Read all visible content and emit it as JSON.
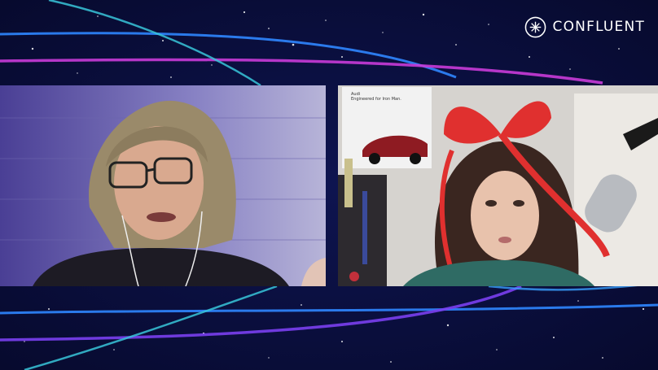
{
  "brand": {
    "name": "CONFLUENT",
    "logo_icon": "confluent-starburst-icon",
    "text_color": "#ffffff"
  },
  "background": {
    "color": "#0b0e3a",
    "stripe_colors": [
      "#1e90ff",
      "#c93bd8",
      "#3aa0ff",
      "#7a3ff0"
    ]
  },
  "participants": [
    {
      "role": "left-speaker",
      "description_icon": "video-feed-man"
    },
    {
      "role": "right-speaker",
      "description_icon": "video-feed-woman"
    }
  ],
  "poster": {
    "line1": "Audi",
    "line2": "Engineered for Iron Man."
  }
}
